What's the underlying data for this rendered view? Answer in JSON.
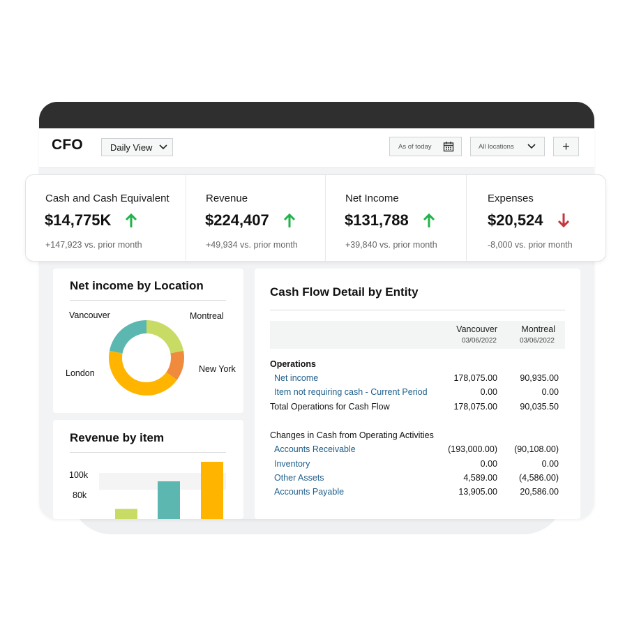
{
  "app": {
    "title": "CFO",
    "view_select": "Daily View",
    "date_filter": "As of today",
    "location_filter": "All locations",
    "add_label": "+"
  },
  "kpis": [
    {
      "label": "Cash and Cash Equivalent",
      "value": "$14,775K",
      "delta": "+147,923 vs. prior month",
      "trend": "up"
    },
    {
      "label": "Revenue",
      "value": "$224,407",
      "delta": "+49,934 vs. prior month",
      "trend": "up"
    },
    {
      "label": "Net Income",
      "value": "$131,788",
      "delta": "+39,840 vs. prior month",
      "trend": "up"
    },
    {
      "label": "Expenses",
      "value": "$20,524",
      "delta": "-8,000 vs. prior month",
      "trend": "down"
    }
  ],
  "colors": {
    "up": "#1fb34a",
    "down": "#c8343c",
    "link": "#1f5f8b",
    "teal": "#5bb7b0",
    "lime": "#c8dc65",
    "orange": "#f08a3c",
    "gold": "#ffb400"
  },
  "net_income_panel": {
    "title": "Net income by Location",
    "chart_data": {
      "type": "pie",
      "labels": [
        "Montreal",
        "New York",
        "London",
        "Vancouver"
      ],
      "values": [
        22,
        13,
        43,
        22
      ],
      "colors": [
        "#c8dc65",
        "#f08a3c",
        "#ffb400",
        "#5bb7b0"
      ]
    }
  },
  "revenue_panel": {
    "title": "Revenue by item",
    "chart_data": {
      "type": "bar",
      "yticks": [
        "100k",
        "80k"
      ],
      "values": [
        76,
        87,
        96
      ],
      "colors": [
        "#c8dc65",
        "#5bb7b0",
        "#ffb400"
      ]
    }
  },
  "cashflow": {
    "title": "Cash Flow Detail by Entity",
    "columns": [
      {
        "name": "Vancouver",
        "date": "03/06/2022"
      },
      {
        "name": "Montreal",
        "date": "03/06/2022"
      }
    ],
    "rows": [
      {
        "label": "Operations",
        "style": "bold",
        "v1": "",
        "v2": ""
      },
      {
        "label": "Net income",
        "style": "link",
        "v1": "178,075.00",
        "v2": "90,935.00"
      },
      {
        "label": "Item not requiring cash - Current Period",
        "style": "link",
        "v1": "0.00",
        "v2": "0.00"
      },
      {
        "label": "Total Operations for Cash Flow",
        "style": "plain",
        "v1": "178,075.00",
        "v2": "90,035.50"
      },
      {
        "label": "Changes in Cash from Operating Activities",
        "style": "plain",
        "v1": "",
        "v2": ""
      },
      {
        "label": "Accounts Receivable",
        "style": "link",
        "v1": "(193,000.00)",
        "v2": "(90,108.00)"
      },
      {
        "label": "Inventory",
        "style": "link",
        "v1": "0.00",
        "v2": "0.00"
      },
      {
        "label": "Other Assets",
        "style": "link",
        "v1": "4,589.00",
        "v2": "(4,586.00)"
      },
      {
        "label": "Accounts Payable",
        "style": "link",
        "v1": "13,905.00",
        "v2": "20,586.00"
      }
    ]
  }
}
